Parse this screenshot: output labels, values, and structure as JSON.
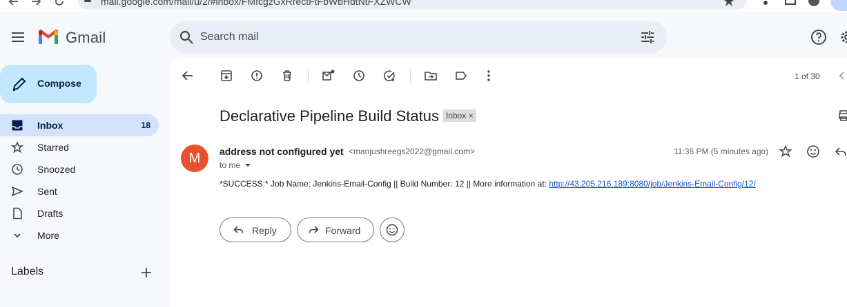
{
  "browser": {
    "url": "mail.google.com/mail/u/2/#inbox/FMfcgzGxRrectFtFbWbHdtNtFXZWCW"
  },
  "header": {
    "app_name": "Gmail",
    "search_placeholder": "Search mail"
  },
  "compose": {
    "label": "Compose"
  },
  "sidebar": {
    "items": [
      {
        "label": "Inbox",
        "count": "18",
        "icon": "inbox-icon",
        "active": true
      },
      {
        "label": "Starred",
        "count": "",
        "icon": "star-icon"
      },
      {
        "label": "Snoozed",
        "count": "",
        "icon": "clock-icon"
      },
      {
        "label": "Sent",
        "count": "",
        "icon": "send-icon"
      },
      {
        "label": "Drafts",
        "count": "",
        "icon": "draft-icon"
      },
      {
        "label": "More",
        "count": "",
        "icon": "chevron-down-icon"
      }
    ],
    "labels_title": "Labels"
  },
  "toolbar": {
    "icons": [
      "back-icon",
      "archive-icon",
      "report-spam-icon",
      "delete-icon",
      "mark-unread-icon",
      "snooze-icon",
      "add-to-tasks-icon",
      "move-to-icon",
      "label-icon",
      "more-icon"
    ],
    "pager": "1 of 30"
  },
  "email": {
    "subject": "Declarative Pipeline Build Status",
    "label_chip": "Inbox",
    "label_chip_close": "×",
    "avatar_letter": "M",
    "avatar_color": "#e8502e",
    "sender_name": "address not configured yet",
    "sender_email": "<manjushreegs2022@gmail.com>",
    "to": "to me",
    "timestamp": "11:36 PM (5 minutes ago)",
    "body_prefix": "*SUCCESS:* Job Name: Jenkins-Email-Config || Build Number: 12 || More information at: ",
    "body_link": "http://43.205.216.189:8080/job/Jenkins-Email-Config/12/"
  },
  "actions": {
    "reply": "Reply",
    "forward": "Forward"
  },
  "colors": {
    "accent": "#0b57d0",
    "compose_bg": "#c2e7ff",
    "active_nav": "#d3e3fd",
    "link": "#1155cc"
  }
}
